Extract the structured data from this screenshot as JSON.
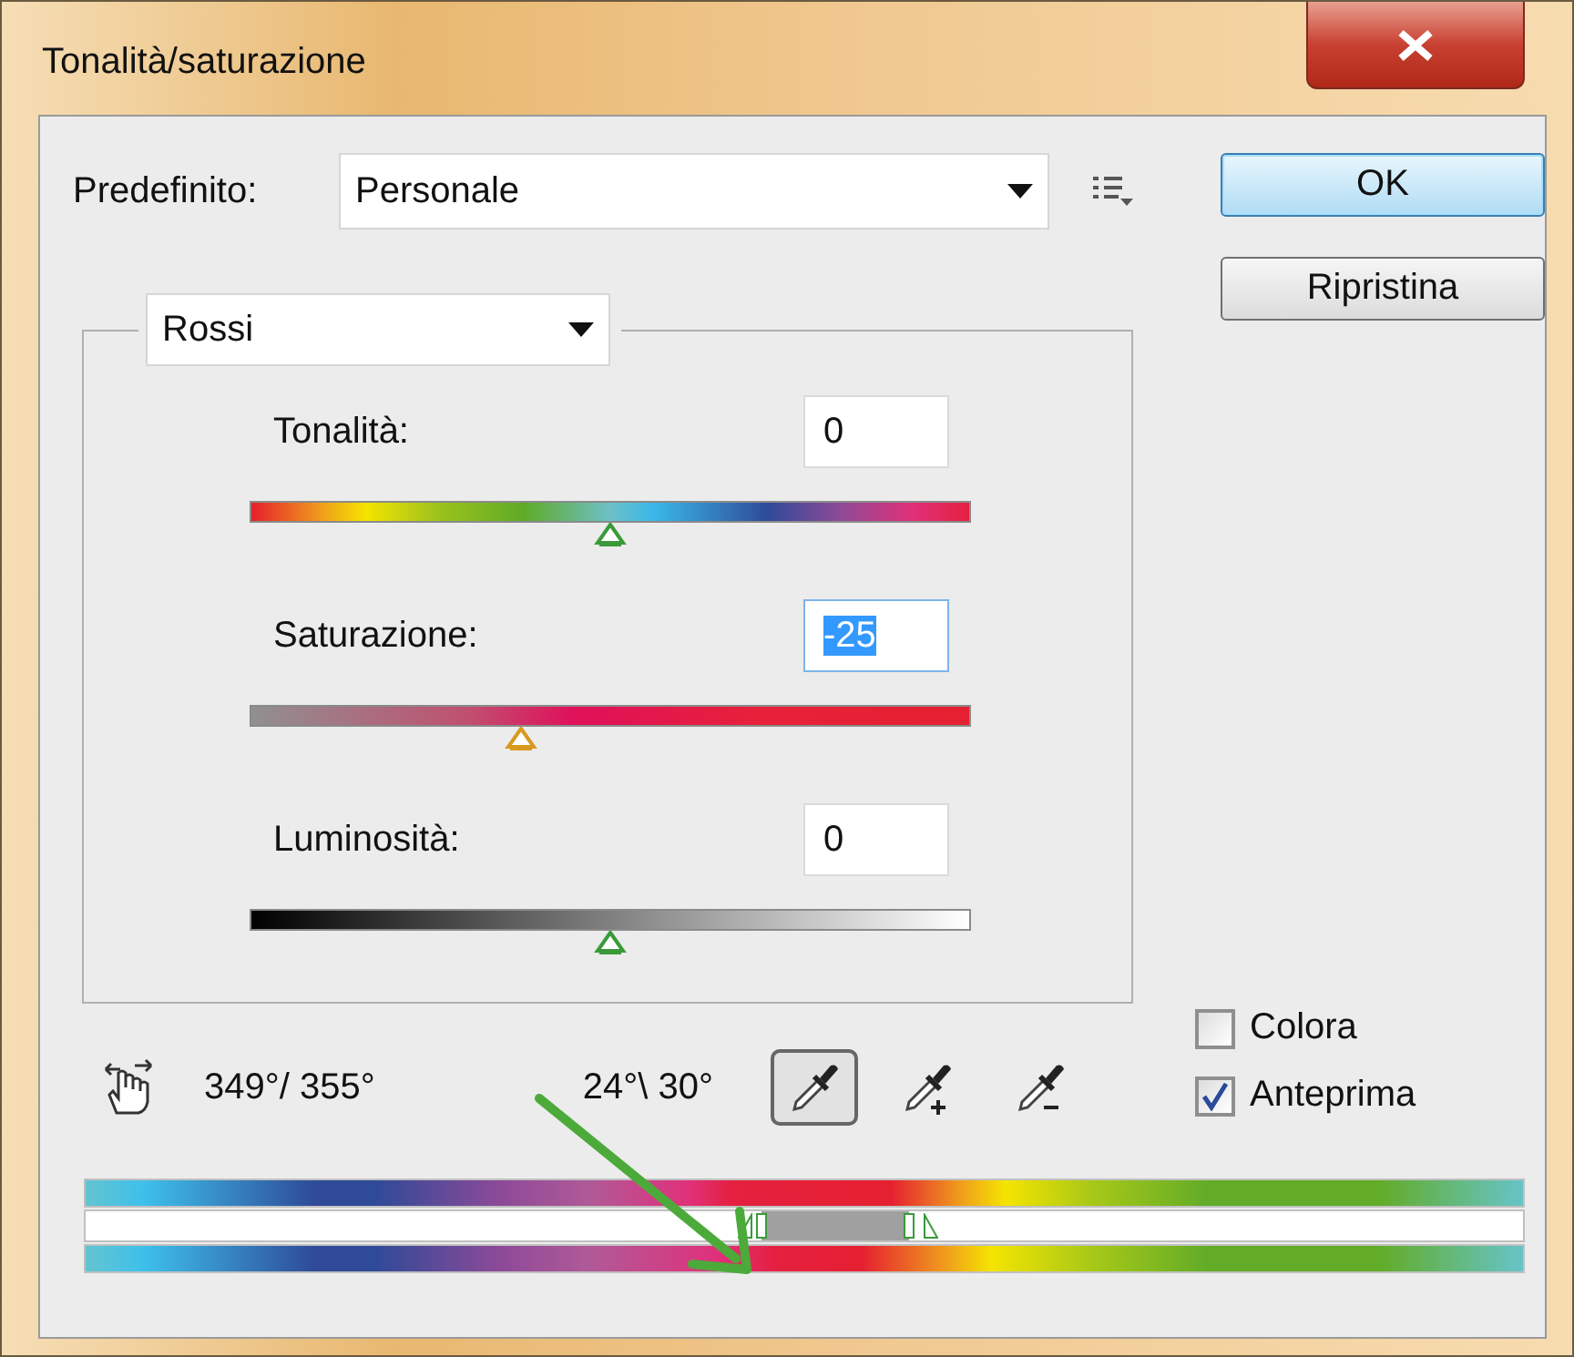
{
  "window": {
    "title": "Tonalità/saturazione"
  },
  "preset": {
    "label": "Predefinito:",
    "value": "Personale"
  },
  "buttons": [
    {
      "label": "OK",
      "default": true
    },
    {
      "label": "Ripristina",
      "default": false
    }
  ],
  "channel": {
    "value": "Rossi"
  },
  "sliders": [
    {
      "kind": "hue",
      "label": "Tonalità:",
      "value": "0",
      "level": 0.5,
      "focused": false
    },
    {
      "kind": "saturation",
      "label": "Saturazione:",
      "value": "-25",
      "level": 0.375,
      "focused": true
    },
    {
      "kind": "lightness",
      "label": "Luminosità:",
      "value": "0",
      "level": 0.5,
      "focused": false
    }
  ],
  "range": {
    "left": "349°/ 355°",
    "right": "24°\\ 30°",
    "handles": [
      {
        "kind": "outer",
        "level": 0.459
      },
      {
        "kind": "inner",
        "level": 0.47
      },
      {
        "kind": "inner",
        "level": 0.573
      },
      {
        "kind": "outer",
        "level": 0.588
      }
    ]
  },
  "tools": [
    {
      "kind": "sample",
      "selected": true
    },
    {
      "kind": "add",
      "selected": false
    },
    {
      "kind": "subtract",
      "selected": false
    }
  ],
  "checkboxes": [
    {
      "label": "Colora",
      "checked": false
    },
    {
      "label": "Anteprima",
      "checked": true
    }
  ]
}
